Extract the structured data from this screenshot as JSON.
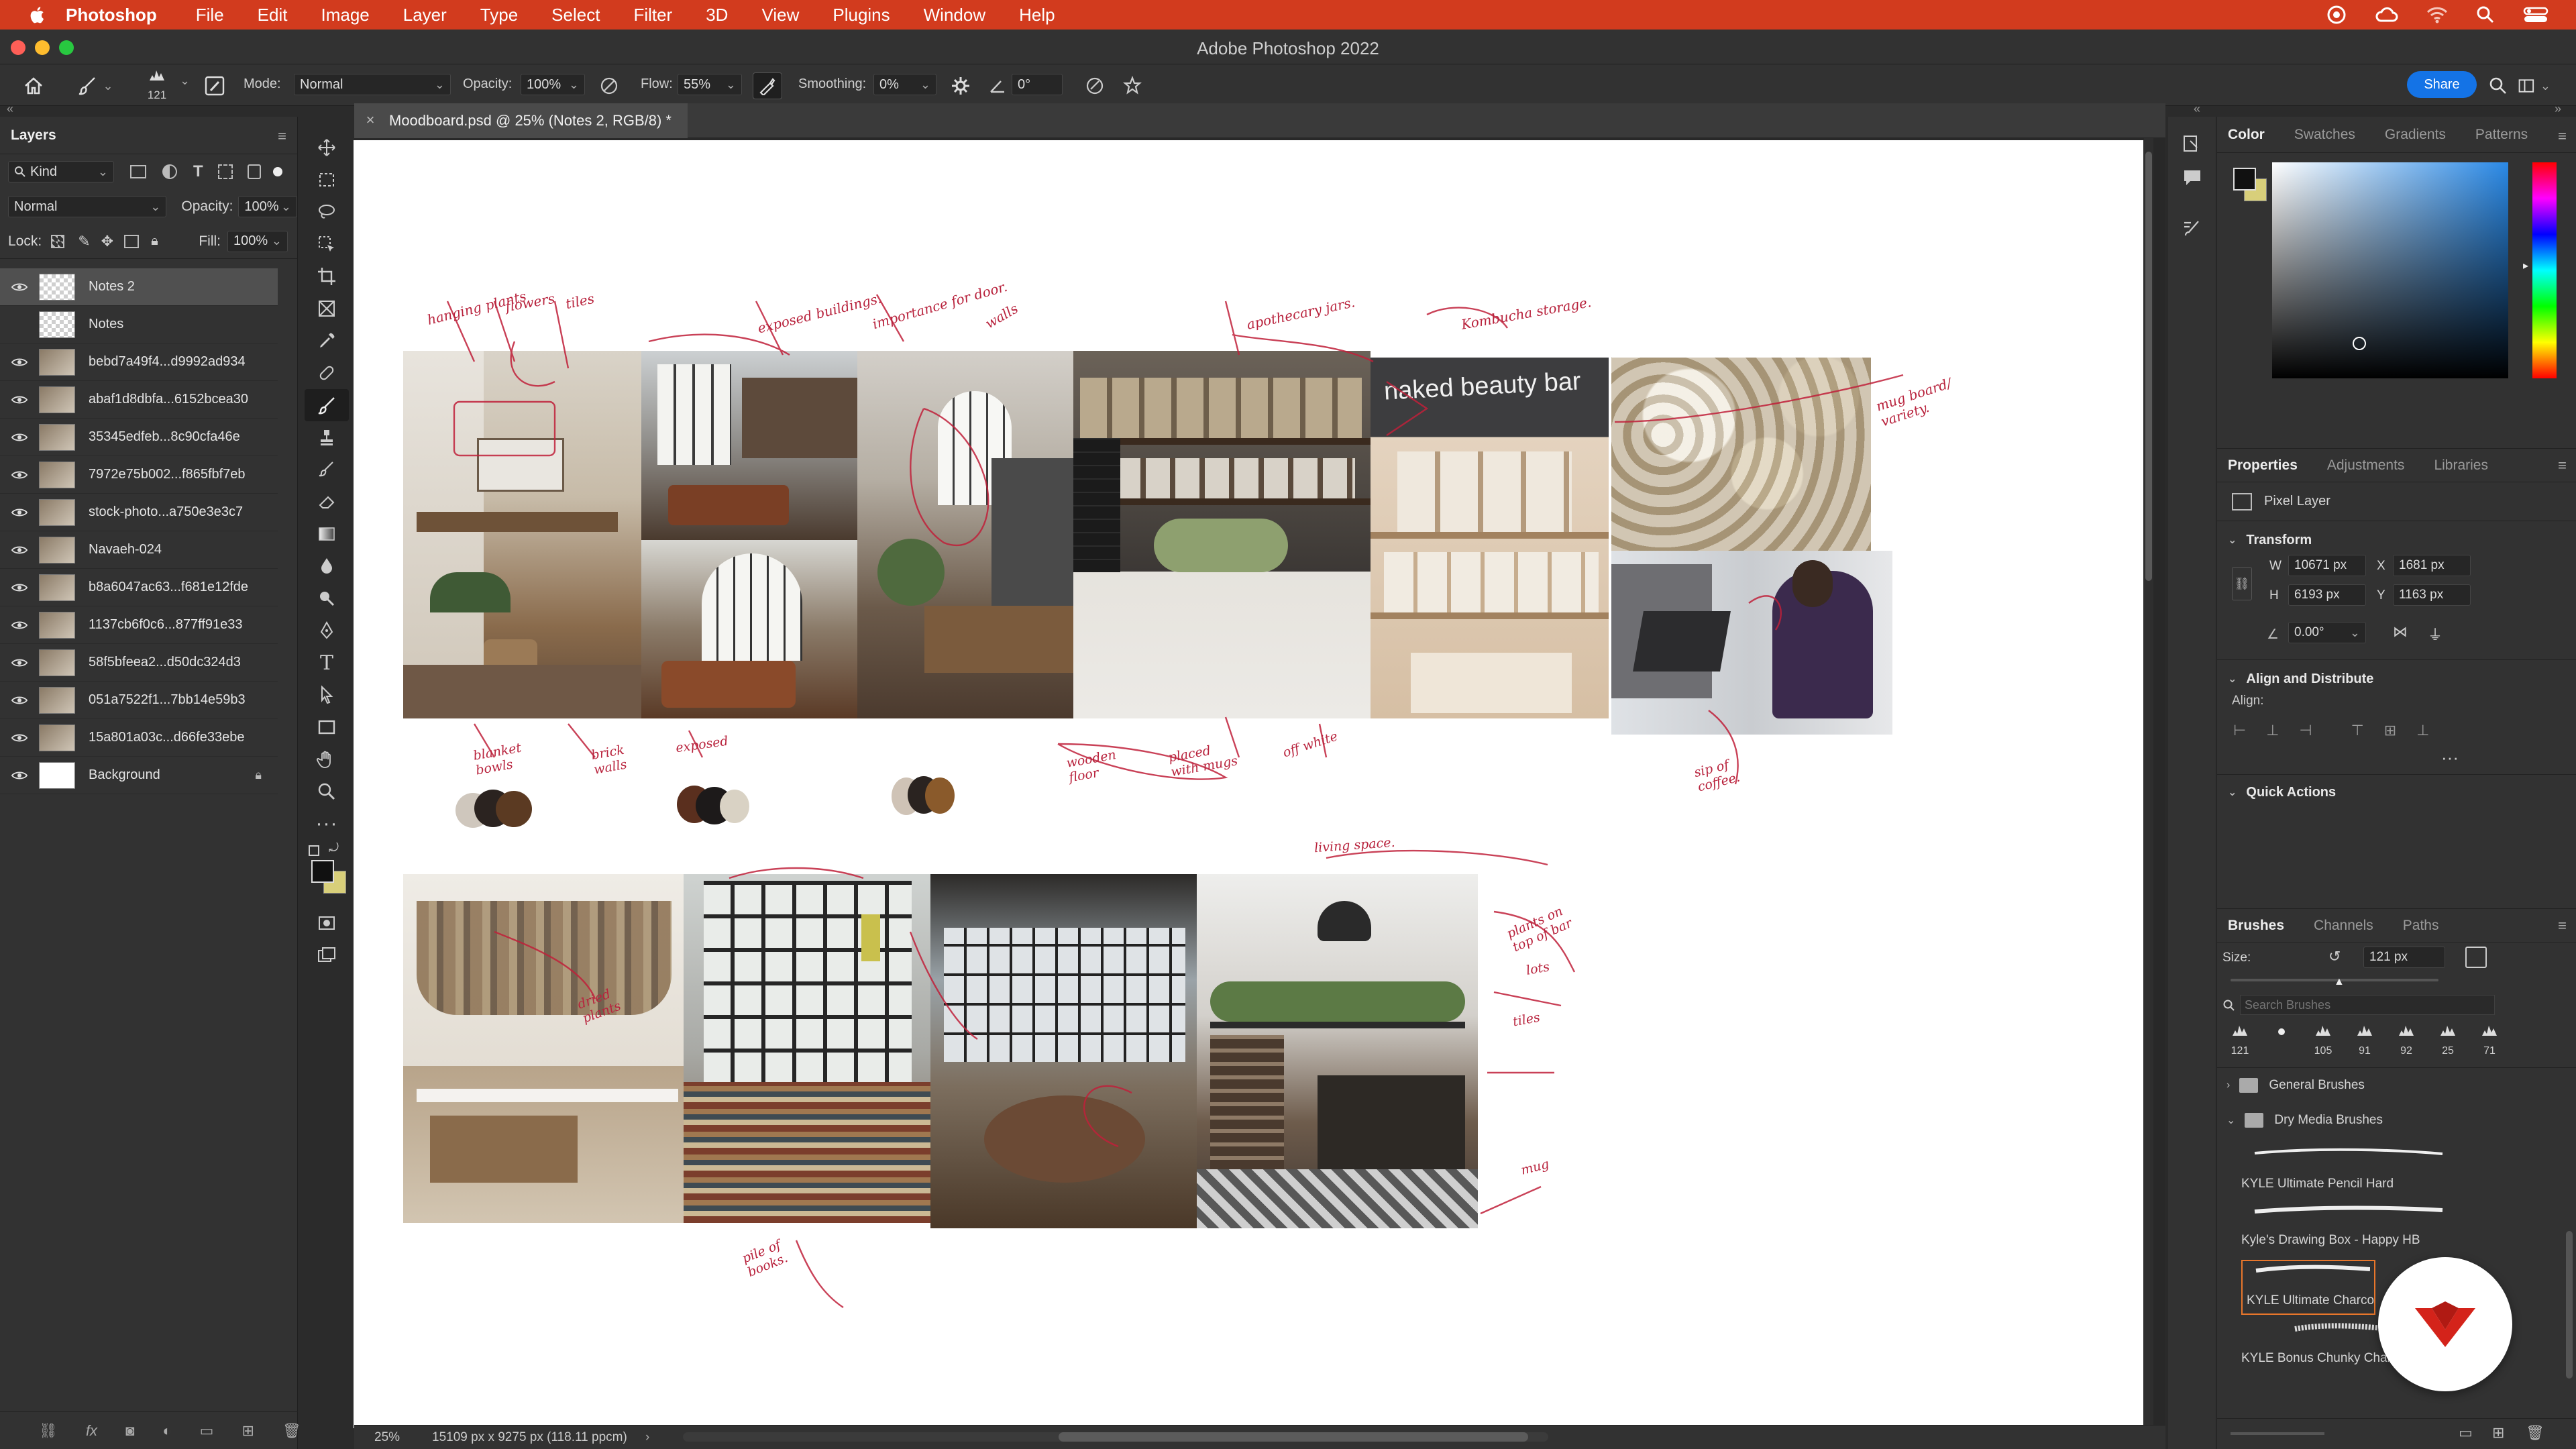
{
  "menubar": {
    "items": [
      "Photoshop",
      "File",
      "Edit",
      "Image",
      "Layer",
      "Type",
      "Select",
      "Filter",
      "3D",
      "View",
      "Plugins",
      "Window",
      "Help"
    ],
    "status_icons": [
      "creative-cloud-icon",
      "cloud-sync-icon",
      "wifi-icon",
      "spotlight-icon",
      "control-center-icon"
    ]
  },
  "window": {
    "title": "Adobe Photoshop 2022"
  },
  "options": {
    "brush_size": "121",
    "mode_label": "Mode:",
    "mode_value": "Normal",
    "opacity_label": "Opacity:",
    "opacity_value": "100%",
    "flow_label": "Flow:",
    "flow_value": "55%",
    "smoothing_label": "Smoothing:",
    "smoothing_value": "0%",
    "angle_value": "0°",
    "share_label": "Share"
  },
  "layers_panel": {
    "tab": "Layers",
    "filter_kind": "Kind",
    "blend_mode": "Normal",
    "opacity_label": "Opacity:",
    "opacity_value": "100%",
    "lock_label": "Lock:",
    "fill_label": "Fill:",
    "fill_value": "100%",
    "layers": [
      {
        "name": "Notes 2",
        "selected": true
      },
      {
        "name": "Notes"
      },
      {
        "name": "bebd7a49f4...d9992ad934"
      },
      {
        "name": "abaf1d8dbfa...6152bcea30"
      },
      {
        "name": "35345edfeb...8c90cfa46e"
      },
      {
        "name": "7972e75b002...f865fbf7eb"
      },
      {
        "name": "stock-photo...a750e3e3c7"
      },
      {
        "name": "Navaeh-024"
      },
      {
        "name": "b8a6047ac63...f681e12fde"
      },
      {
        "name": "1137cb6f0c6...877ff91e33"
      },
      {
        "name": "58f5bfeea2...d50dc324d3"
      },
      {
        "name": "051a7522f1...7bb14e59b3"
      },
      {
        "name": "15a801a03c...d66fe33ebe"
      },
      {
        "name": "Background"
      }
    ]
  },
  "document": {
    "tab_title": "Moodboard.psd @ 25% (Notes 2, RGB/8) *",
    "zoom": "25%",
    "dimensions": "15109 px x 9275 px (118.11 ppcm)",
    "sign_text": "naked beauty bar",
    "annotations": [
      "hanging plants",
      "flowers",
      "tiles",
      "exposed buildings.",
      "importance for door.",
      "walls",
      "apothecary jars.",
      "Kombucha storage.",
      "mug board/ variety.",
      "blanket bowls",
      "brick walls",
      "exposed",
      "wooden floor",
      "placed with mugs",
      "off white",
      "sip of coffee.",
      "living space.",
      "plants on top of bar",
      "lots",
      "tiles",
      "mug",
      "pile of books.",
      "dried plants"
    ],
    "swatches": [
      [
        "#cfc7bd",
        "#2b2320",
        "#5b3a22"
      ],
      [
        "#5a2f1e",
        "#1d1a1a",
        "#d9d2c4"
      ],
      [
        "#cfc3b6",
        "#2a2320",
        "#8a5a2b"
      ]
    ]
  },
  "color_panel": {
    "tabs": [
      "Color",
      "Swatches",
      "Gradients",
      "Patterns"
    ],
    "foreground": "#111111",
    "background": "#d8cf7a"
  },
  "properties_panel": {
    "tabs": [
      "Properties",
      "Adjustments",
      "Libraries"
    ],
    "layer_type": "Pixel Layer",
    "transform_title": "Transform",
    "w_label": "W",
    "w_value": "10671 px",
    "x_label": "X",
    "x_value": "1681 px",
    "h_label": "H",
    "h_value": "6193 px",
    "y_label": "Y",
    "y_value": "1163 px",
    "angle_value": "0.00°",
    "align_title": "Align and Distribute",
    "align_label": "Align:",
    "quick_actions_title": "Quick Actions"
  },
  "brushes_panel": {
    "tabs": [
      "Brushes",
      "Channels",
      "Paths"
    ],
    "size_label": "Size:",
    "size_value": "121 px",
    "search_placeholder": "Search Brushes",
    "recent_sizes": [
      "121",
      "",
      "105",
      "91",
      "92",
      "25",
      "71"
    ],
    "groups": [
      "General Brushes",
      "Dry Media Brushes"
    ],
    "brushes": [
      "KYLE Ultimate Pencil Hard",
      "Kyle's Drawing Box - Happy HB",
      "KYLE Ultimate Charcoal",
      "KYLE Bonus Chunky Charcoal"
    ]
  },
  "colors": {
    "menubar": "#d23b1e",
    "accent": "#1473e6",
    "annotation": "#c0203a"
  }
}
